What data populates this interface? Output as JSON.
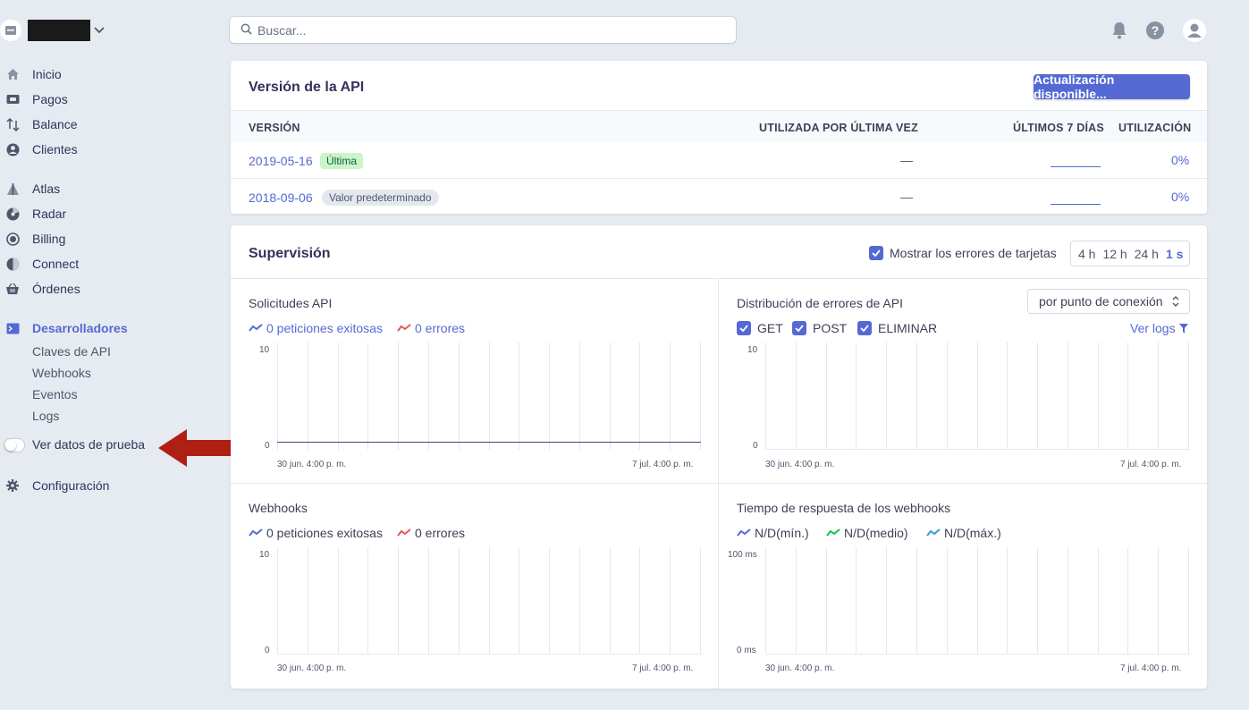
{
  "account": {
    "icon": "store-icon"
  },
  "search": {
    "placeholder": "Buscar..."
  },
  "nav": {
    "main": [
      {
        "label": "Inicio",
        "icon": "home-icon"
      },
      {
        "label": "Pagos",
        "icon": "payments-icon"
      },
      {
        "label": "Balance",
        "icon": "balance-icon"
      },
      {
        "label": "Clientes",
        "icon": "customers-icon"
      }
    ],
    "products": [
      {
        "label": "Atlas",
        "icon": "atlas-icon"
      },
      {
        "label": "Radar",
        "icon": "radar-icon"
      },
      {
        "label": "Billing",
        "icon": "billing-icon"
      },
      {
        "label": "Connect",
        "icon": "connect-icon"
      },
      {
        "label": "Órdenes",
        "icon": "orders-icon"
      }
    ],
    "developers": {
      "label": "Desarrolladores",
      "icon": "terminal-icon",
      "items": [
        "Claves de API",
        "Webhooks",
        "Eventos",
        "Logs"
      ]
    },
    "test_toggle": {
      "label": "Ver datos de prueba",
      "on": false
    },
    "settings": {
      "label": "Configuración",
      "icon": "gear-icon"
    }
  },
  "api_card": {
    "title": "Versión de la API",
    "button": "Actualización disponible...",
    "headers": [
      "VERSIÓN",
      "UTILIZADA POR ÚLTIMA VEZ",
      "ÚLTIMOS 7 DÍAS",
      "UTILIZACIÓN"
    ],
    "rows": [
      {
        "version": "2019-05-16",
        "badge": "Última",
        "last_used": "—",
        "usage": "0%"
      },
      {
        "version": "2018-09-06",
        "badge": "Valor predeterminado",
        "last_used": "—",
        "usage": "0%"
      }
    ]
  },
  "monitor": {
    "title": "Supervisión",
    "show_errors": "Mostrar los errores de tarjetas",
    "ranges": [
      "4 h",
      "12 h",
      "24 h",
      "1 s"
    ],
    "active_range": "1 s",
    "panels": {
      "api_requests": {
        "title": "Solicitudes API",
        "legend_ok": "0 peticiones exitosas",
        "legend_err": "0 errores",
        "ymax": "10",
        "ymin": "0",
        "x_start": "30 jun. 4:00 p. m.",
        "x_end": "7 jul. 4:00 p. m."
      },
      "api_errors": {
        "title": "Distribución de errores de API",
        "select": "por punto de conexión",
        "methods": [
          "GET",
          "POST",
          "ELIMINAR"
        ],
        "logs_link": "Ver logs",
        "ymax": "10",
        "ymin": "0",
        "x_start": "30 jun. 4:00 p. m.",
        "x_end": "7 jul. 4:00 p. m."
      },
      "webhooks": {
        "title": "Webhooks",
        "legend_ok": "0 peticiones exitosas",
        "legend_err": "0 errores",
        "ymax": "10",
        "ymin": "0",
        "x_start": "30 jun. 4:00 p. m.",
        "x_end": "7 jul. 4:00 p. m."
      },
      "webhook_latency": {
        "title": "Tiempo de respuesta de los webhooks",
        "legend": [
          "N/D(mín.)",
          "N/D(medio)",
          "N/D(máx.)"
        ],
        "ymax": "100 ms",
        "ymin": "0 ms",
        "x_start": "30 jun. 4:00 p. m.",
        "x_end": "7 jul. 4:00 p. m."
      }
    }
  },
  "colors": {
    "accent": "#5469d4",
    "error": "#e25950",
    "green": "#15be53",
    "teal": "#3a97d4",
    "annotation_arrow": "#b01f14"
  }
}
